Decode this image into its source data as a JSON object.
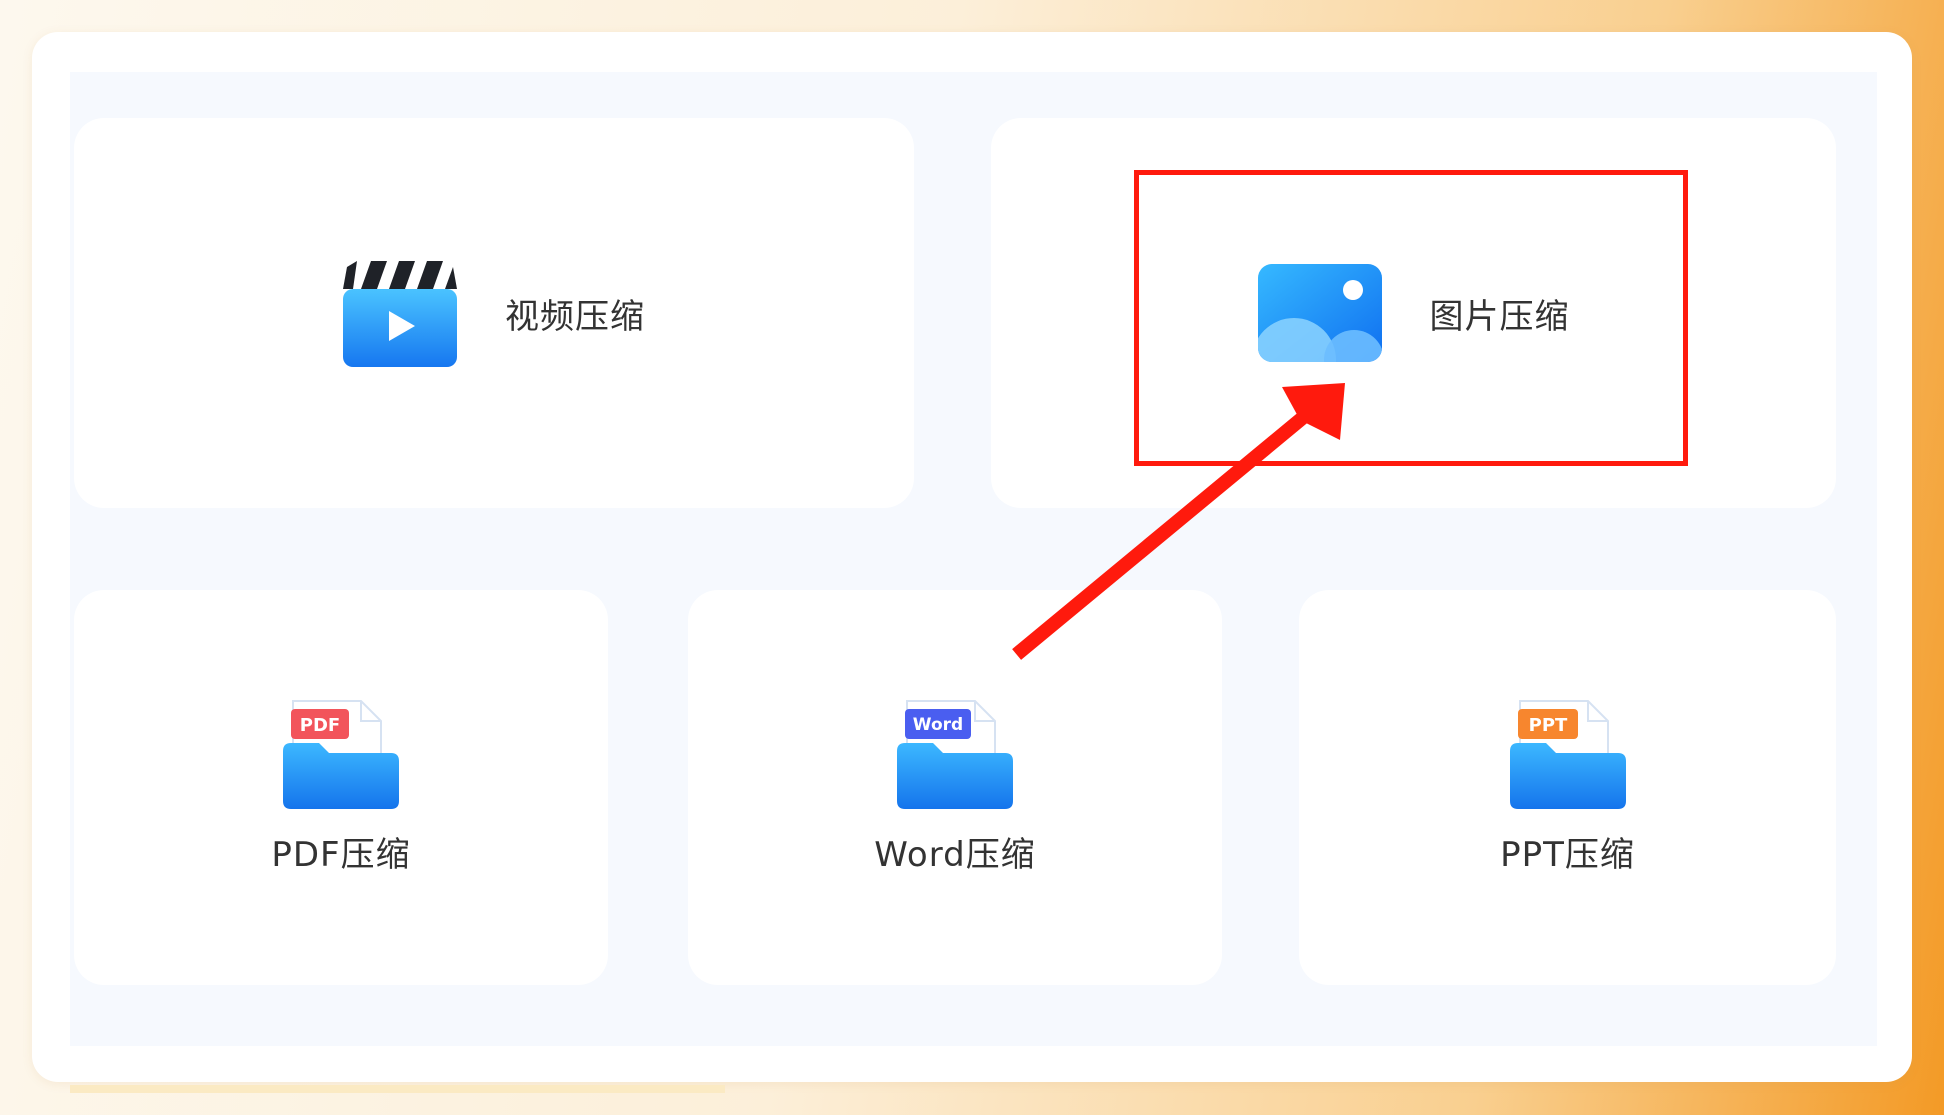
{
  "cards": {
    "video": {
      "label": "视频压缩",
      "icon": "video-clapper-icon"
    },
    "image": {
      "label": "图片压缩",
      "icon": "image-photo-icon"
    },
    "pdf": {
      "label": "PDF压缩",
      "icon": "pdf-folder-icon",
      "tag": "PDF",
      "tag_color": "#f2545b"
    },
    "word": {
      "label": "Word压缩",
      "icon": "word-folder-icon",
      "tag": "Word",
      "tag_color": "#4a5ef0"
    },
    "ppt": {
      "label": "PPT压缩",
      "icon": "ppt-folder-icon",
      "tag": "PPT",
      "tag_color": "#f7862e"
    }
  },
  "annotation": {
    "highlight_color": "#ff1a0d",
    "target": "image"
  }
}
